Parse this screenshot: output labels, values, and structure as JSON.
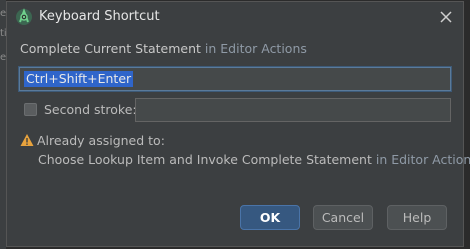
{
  "window": {
    "title": "Keyboard Shortcut",
    "close_icon": "close-icon",
    "app_icon": "android-studio-icon"
  },
  "action": {
    "name": "Complete Current Statement",
    "connector": " in ",
    "group": "Editor Actions"
  },
  "first_stroke": {
    "value": "Ctrl+Shift+Enter"
  },
  "second_stroke": {
    "label": "Second stroke:",
    "checked": false,
    "value": ""
  },
  "conflict": {
    "title": "Already assigned to:",
    "action_name": "Choose Lookup Item and Invoke Complete Statement",
    "connector": " in ",
    "group": "Editor Actions",
    "icon": "warning-icon"
  },
  "buttons": {
    "ok": "OK",
    "cancel": "Cancel",
    "help": "Help"
  },
  "colors": {
    "accent": "#365880",
    "selection": "#2f65ca",
    "warning": "#e8a33d"
  }
}
